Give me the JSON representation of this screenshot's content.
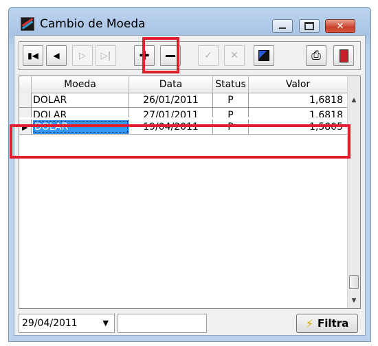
{
  "window": {
    "title": "Cambio de Moeda"
  },
  "toolbar": {
    "buttons": [
      {
        "name": "first",
        "glyph": "I◀"
      },
      {
        "name": "prior",
        "glyph": "◀"
      },
      {
        "name": "next",
        "glyph": "▷"
      },
      {
        "name": "last",
        "glyph": "▷I"
      },
      {
        "name": "insert",
        "glyph": "+"
      },
      {
        "name": "delete",
        "glyph": "—"
      },
      {
        "name": "edit",
        "glyph": "✓"
      },
      {
        "name": "cancel",
        "glyph": "✕"
      },
      {
        "name": "export",
        "glyph": "▦"
      },
      {
        "name": "print",
        "glyph": "⎙"
      },
      {
        "name": "exit",
        "glyph": "▮"
      }
    ]
  },
  "grid": {
    "columns": [
      "Moeda",
      "Data",
      "Status",
      "Valor"
    ],
    "rows": [
      {
        "moeda": "DOLAR",
        "data": "26/01/2011",
        "status": "P",
        "valor": "1,6818"
      },
      {
        "moeda": "DOLAR",
        "data": "27/01/2011",
        "status": "P",
        "valor": "1,6818"
      },
      {
        "moeda": "DOLAR",
        "data": "19/04/2011",
        "status": "P",
        "valor": "1,5805"
      }
    ]
  },
  "filter": {
    "date_value": "29/04/2011",
    "text_value": "",
    "button_label": "Filtra"
  },
  "colors": {
    "highlight": "#e0202e",
    "selection": "#3399ff"
  }
}
